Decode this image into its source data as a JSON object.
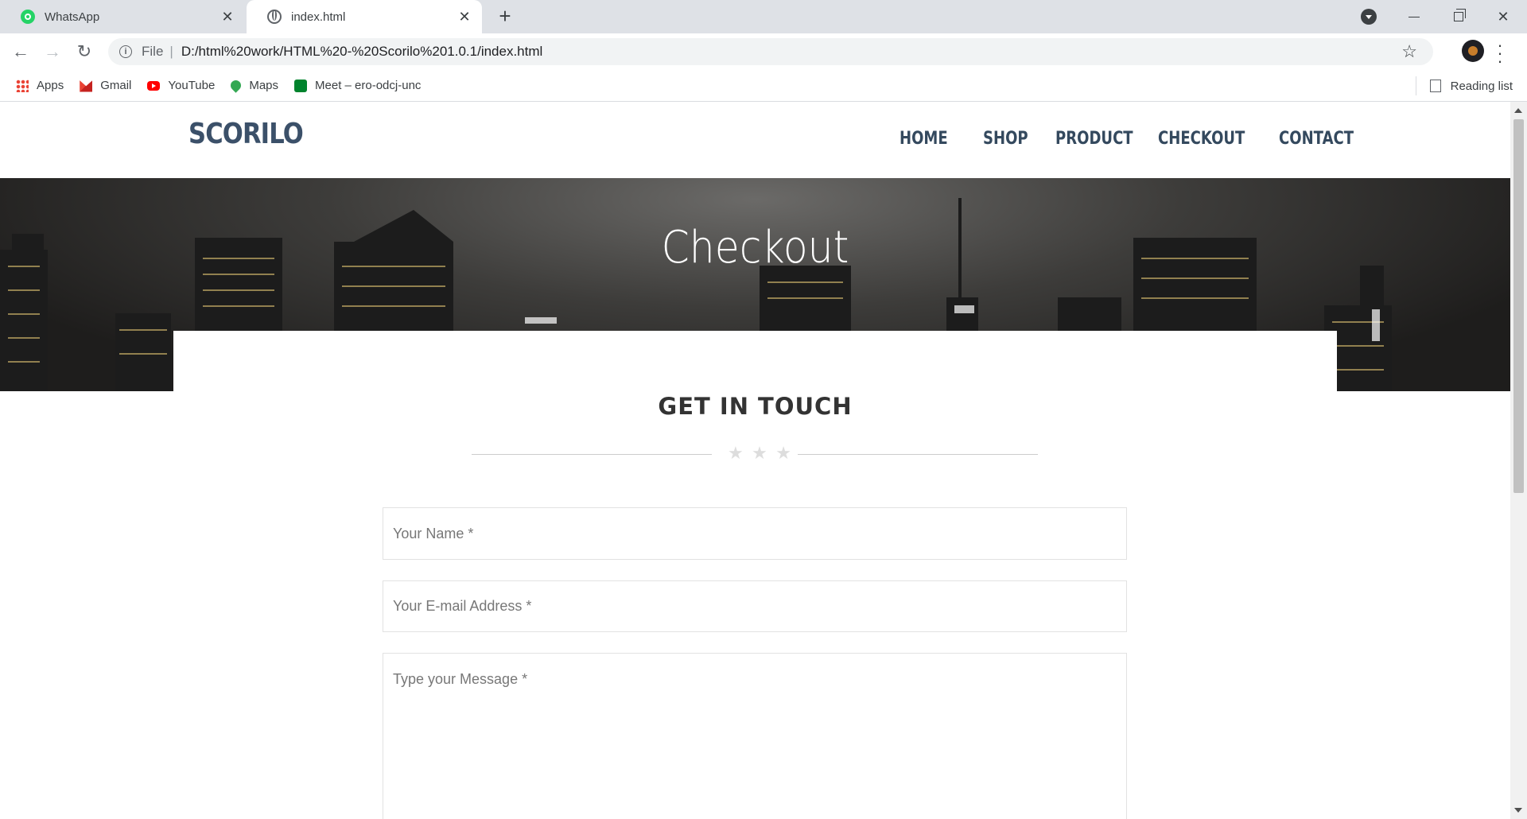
{
  "browser": {
    "tabs": [
      {
        "title": "WhatsApp",
        "icon": "whatsapp-icon",
        "active": false
      },
      {
        "title": "index.html",
        "icon": "globe-icon",
        "active": true
      }
    ],
    "address": {
      "scheme_label": "File",
      "separator": "|",
      "url": "D:/html%20work/HTML%20-%20Scorilo%201.0.1/index.html"
    },
    "bookmarks": [
      {
        "label": "Apps",
        "icon": "apps-grid-icon"
      },
      {
        "label": "Gmail",
        "icon": "gmail-icon"
      },
      {
        "label": "YouTube",
        "icon": "youtube-icon"
      },
      {
        "label": "Maps",
        "icon": "maps-icon"
      },
      {
        "label": "Meet – ero-odcj-unc",
        "icon": "meet-icon"
      }
    ],
    "reading_list": "Reading list"
  },
  "site": {
    "logo": "SCORILO",
    "nav": [
      "HOME",
      "SHOP",
      "PRODUCT",
      "CHECKOUT",
      "CONTACT"
    ],
    "hero_title": "Checkout"
  },
  "contact": {
    "title": "GET IN TOUCH",
    "name_placeholder": "Your Name *",
    "email_placeholder": "Your E-mail Address *",
    "message_placeholder": "Type your Message *"
  },
  "colors": {
    "brand": "#3b5069",
    "nav": "#34495e",
    "chrome_tabstrip": "#dee1e6"
  }
}
